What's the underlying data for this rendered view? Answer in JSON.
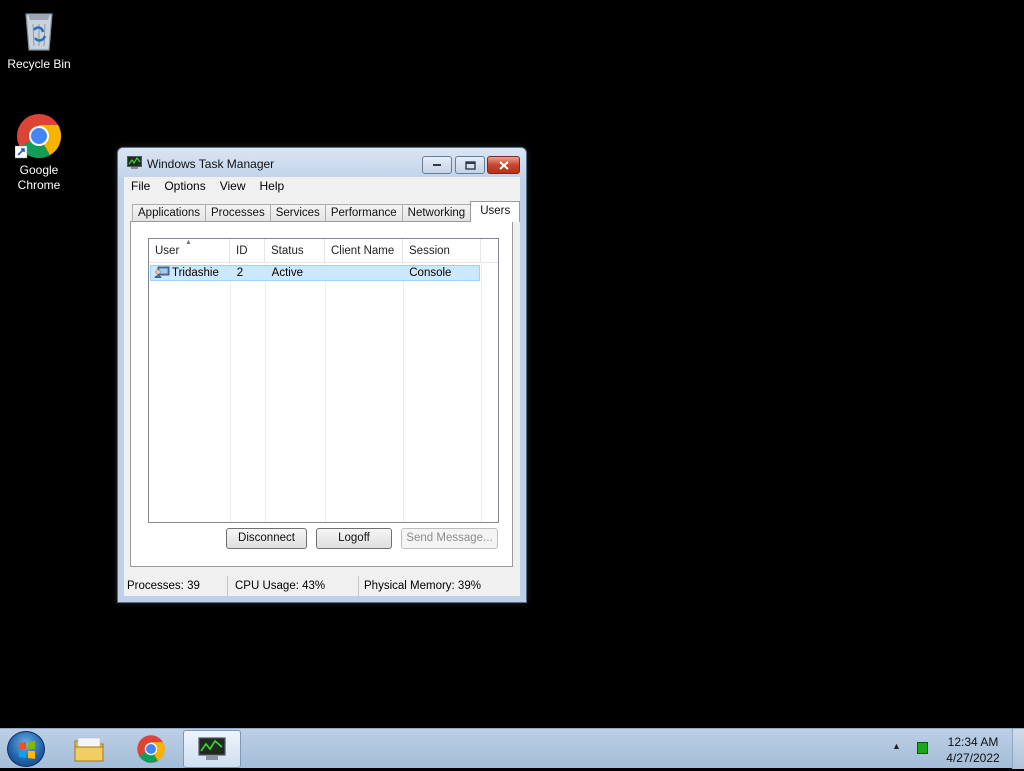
{
  "desktop": {
    "icons": [
      {
        "label": "Recycle Bin"
      },
      {
        "label": "Google Chrome"
      }
    ]
  },
  "window": {
    "title": "Windows Task Manager",
    "menu": [
      "File",
      "Options",
      "View",
      "Help"
    ],
    "tabs": [
      "Applications",
      "Processes",
      "Services",
      "Performance",
      "Networking",
      "Users"
    ],
    "active_tab": "Users",
    "columns": [
      "User",
      "ID",
      "Status",
      "Client Name",
      "Session"
    ],
    "rows": [
      {
        "user": "Tridashie",
        "id": "2",
        "status": "Active",
        "client_name": "",
        "session": "Console"
      }
    ],
    "buttons": {
      "disconnect": "Disconnect",
      "logoff": "Logoff",
      "send_message": "Send Message..."
    },
    "status": {
      "processes": "Processes: 39",
      "cpu": "CPU Usage: 43%",
      "memory": "Physical Memory: 39%"
    }
  },
  "taskbar": {
    "time": "12:34 AM",
    "date": "4/27/2022",
    "pinned": [
      "start-orb",
      "windows-explorer-icon",
      "google-chrome-icon",
      "task-manager-icon"
    ]
  },
  "colors": {
    "selection": "#cce8ff",
    "close_button": "#c8442c",
    "taskbar": "#bcd0e6"
  }
}
